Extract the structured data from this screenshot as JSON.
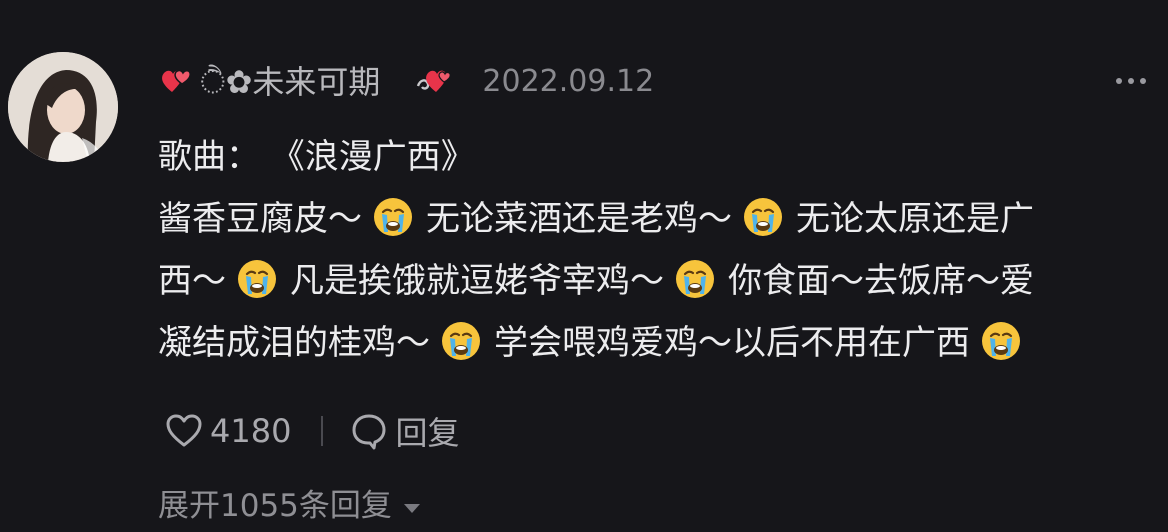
{
  "comment": {
    "avatar_icon": "avatar",
    "username": "ੈ✿未来可期",
    "timestamp": "2022.09.12",
    "more_icon": "more-icon",
    "lines": [
      {
        "segments": [
          "歌曲：  《浪漫广西》"
        ]
      },
      {
        "segments": [
          "酱香豆腐皮～",
          "无论菜酒还是老鸡～",
          "无论太原还是广"
        ]
      },
      {
        "segments": [
          "西～",
          "凡是挨饿就逗姥爷宰鸡～",
          "你食面～去饭席～爱"
        ]
      },
      {
        "segments": [
          "凝结成泪的桂鸡～",
          "学会喂鸡爱鸡～以后不用在广西",
          ""
        ]
      }
    ],
    "emoji_icon": "crying-face-icon",
    "likes": "4180",
    "reply_label": "回复",
    "expand_label": "展开1055条回复"
  },
  "colors": {
    "background": "#16161a",
    "text": "#ececee",
    "muted": "#a9a9ae",
    "heart": "#e8344a"
  }
}
